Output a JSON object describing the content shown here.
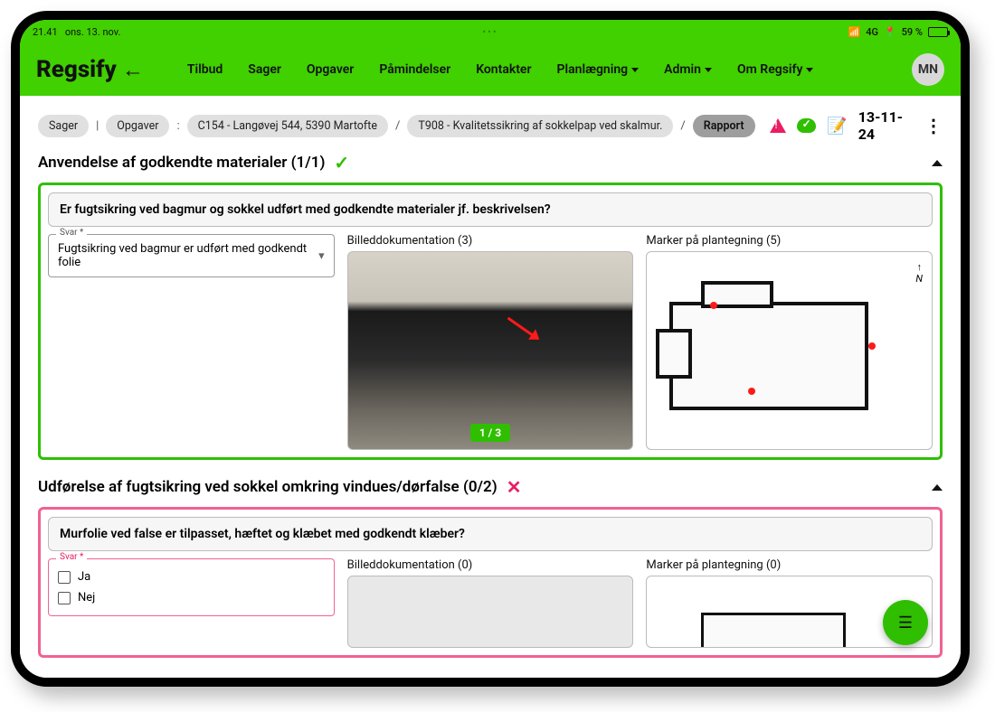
{
  "status": {
    "time": "21.41",
    "date": "ons. 13. nov.",
    "network": "4G",
    "battery_pct": "59 %"
  },
  "brand": "Regsify",
  "nav": {
    "tilbud": "Tilbud",
    "sager": "Sager",
    "opgaver": "Opgaver",
    "pamindelser": "Påmindelser",
    "kontakter": "Kontakter",
    "planlaegning": "Planlægning",
    "admin": "Admin",
    "om": "Om Regsify"
  },
  "avatar": "MN",
  "crumbs": {
    "sager": "Sager",
    "opgaver": "Opgaver",
    "case": "C154 - Langøvej 544, 5390 Martofte",
    "task": "T908 - Kvalitetssikring af sokkelpap ved skalmur.",
    "rapport": "Rapport"
  },
  "topbar_date": "13-11-24",
  "section1": {
    "title": "Anvendelse af godkendte materialer",
    "count": "(1/1)",
    "question": "Er fugtsikring ved bagmur og sokkel udført med godkendte materialer jf. beskrivelsen?",
    "answer_label": "Svar *",
    "answer_value": "Fugtsikring ved bagmur er udført med godkendt folie",
    "photo_label": "Billeddokumentation (3)",
    "photo_badge": "1 / 3",
    "plan_label": "Marker på plantegning (5)",
    "compass": "N"
  },
  "section2": {
    "title": "Udførelse af fugtsikring ved sokkel omkring vindues/dørfalse",
    "count": "(0/2)",
    "question": "Murfolie ved false er tilpasset, hæftet og klæbet med godkendt klæber?",
    "answer_label": "Svar *",
    "opt_ja": "Ja",
    "opt_nej": "Nej",
    "photo_label": "Billeddokumentation (0)",
    "plan_label": "Marker på plantegning (0)"
  }
}
